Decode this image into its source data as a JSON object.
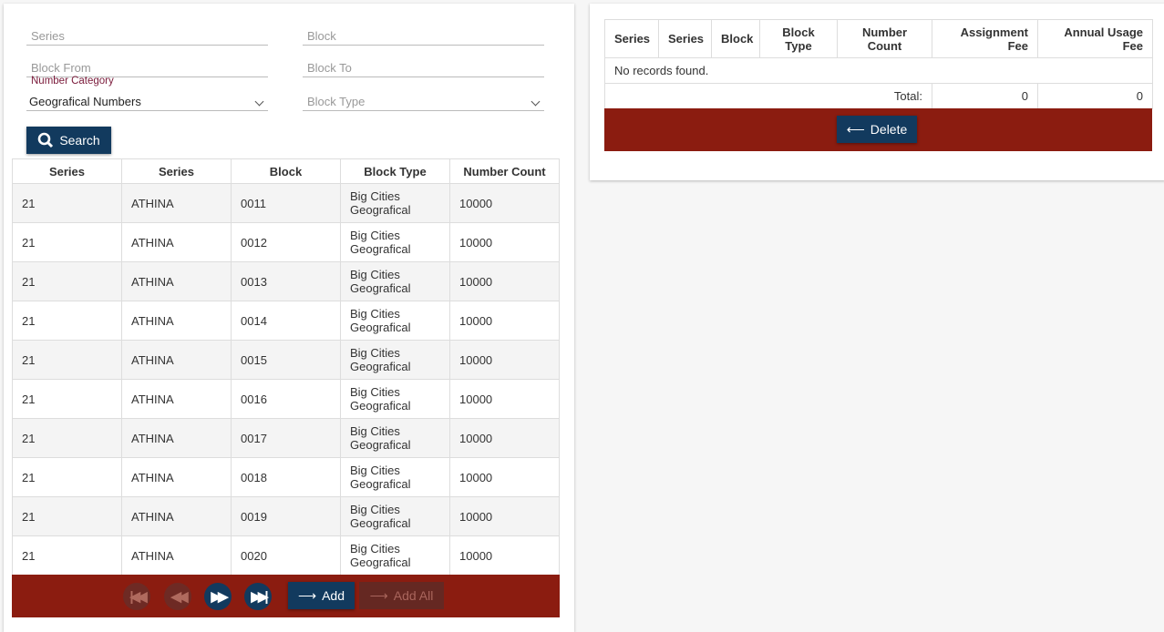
{
  "filters": {
    "series_placeholder": "Series",
    "block_placeholder": "Block",
    "block_from_placeholder": "Block From",
    "block_to_placeholder": "Block To",
    "number_category_label": "Number Category",
    "number_category_value": "Geografical Numbers",
    "block_type_placeholder": "Block Type",
    "search_label": "Search"
  },
  "results": {
    "headers": [
      "Series",
      "Series",
      "Block",
      "Block Type",
      "Number Count"
    ],
    "rows": [
      [
        "21",
        "ATHINA",
        "0011",
        "Big Cities Geografical",
        "10000"
      ],
      [
        "21",
        "ATHINA",
        "0012",
        "Big Cities Geografical",
        "10000"
      ],
      [
        "21",
        "ATHINA",
        "0013",
        "Big Cities Geografical",
        "10000"
      ],
      [
        "21",
        "ATHINA",
        "0014",
        "Big Cities Geografical",
        "10000"
      ],
      [
        "21",
        "ATHINA",
        "0015",
        "Big Cities Geografical",
        "10000"
      ],
      [
        "21",
        "ATHINA",
        "0016",
        "Big Cities Geografical",
        "10000"
      ],
      [
        "21",
        "ATHINA",
        "0017",
        "Big Cities Geografical",
        "10000"
      ],
      [
        "21",
        "ATHINA",
        "0018",
        "Big Cities Geografical",
        "10000"
      ],
      [
        "21",
        "ATHINA",
        "0019",
        "Big Cities Geografical",
        "10000"
      ],
      [
        "21",
        "ATHINA",
        "0020",
        "Big Cities Geografical",
        "10000"
      ]
    ],
    "add_label": "Add",
    "add_all_label": "Add All"
  },
  "selected": {
    "headers": [
      "Series",
      "Series",
      "Block",
      "Block Type",
      "Number Count",
      "Assignment Fee",
      "Annual Usage Fee"
    ],
    "empty_message": "No records found.",
    "total_label": "Total:",
    "total_assignment_fee": "0",
    "total_annual_usage_fee": "0",
    "delete_label": "Delete"
  },
  "colors": {
    "primary": "#123a5e",
    "footer": "#8b1c10"
  }
}
